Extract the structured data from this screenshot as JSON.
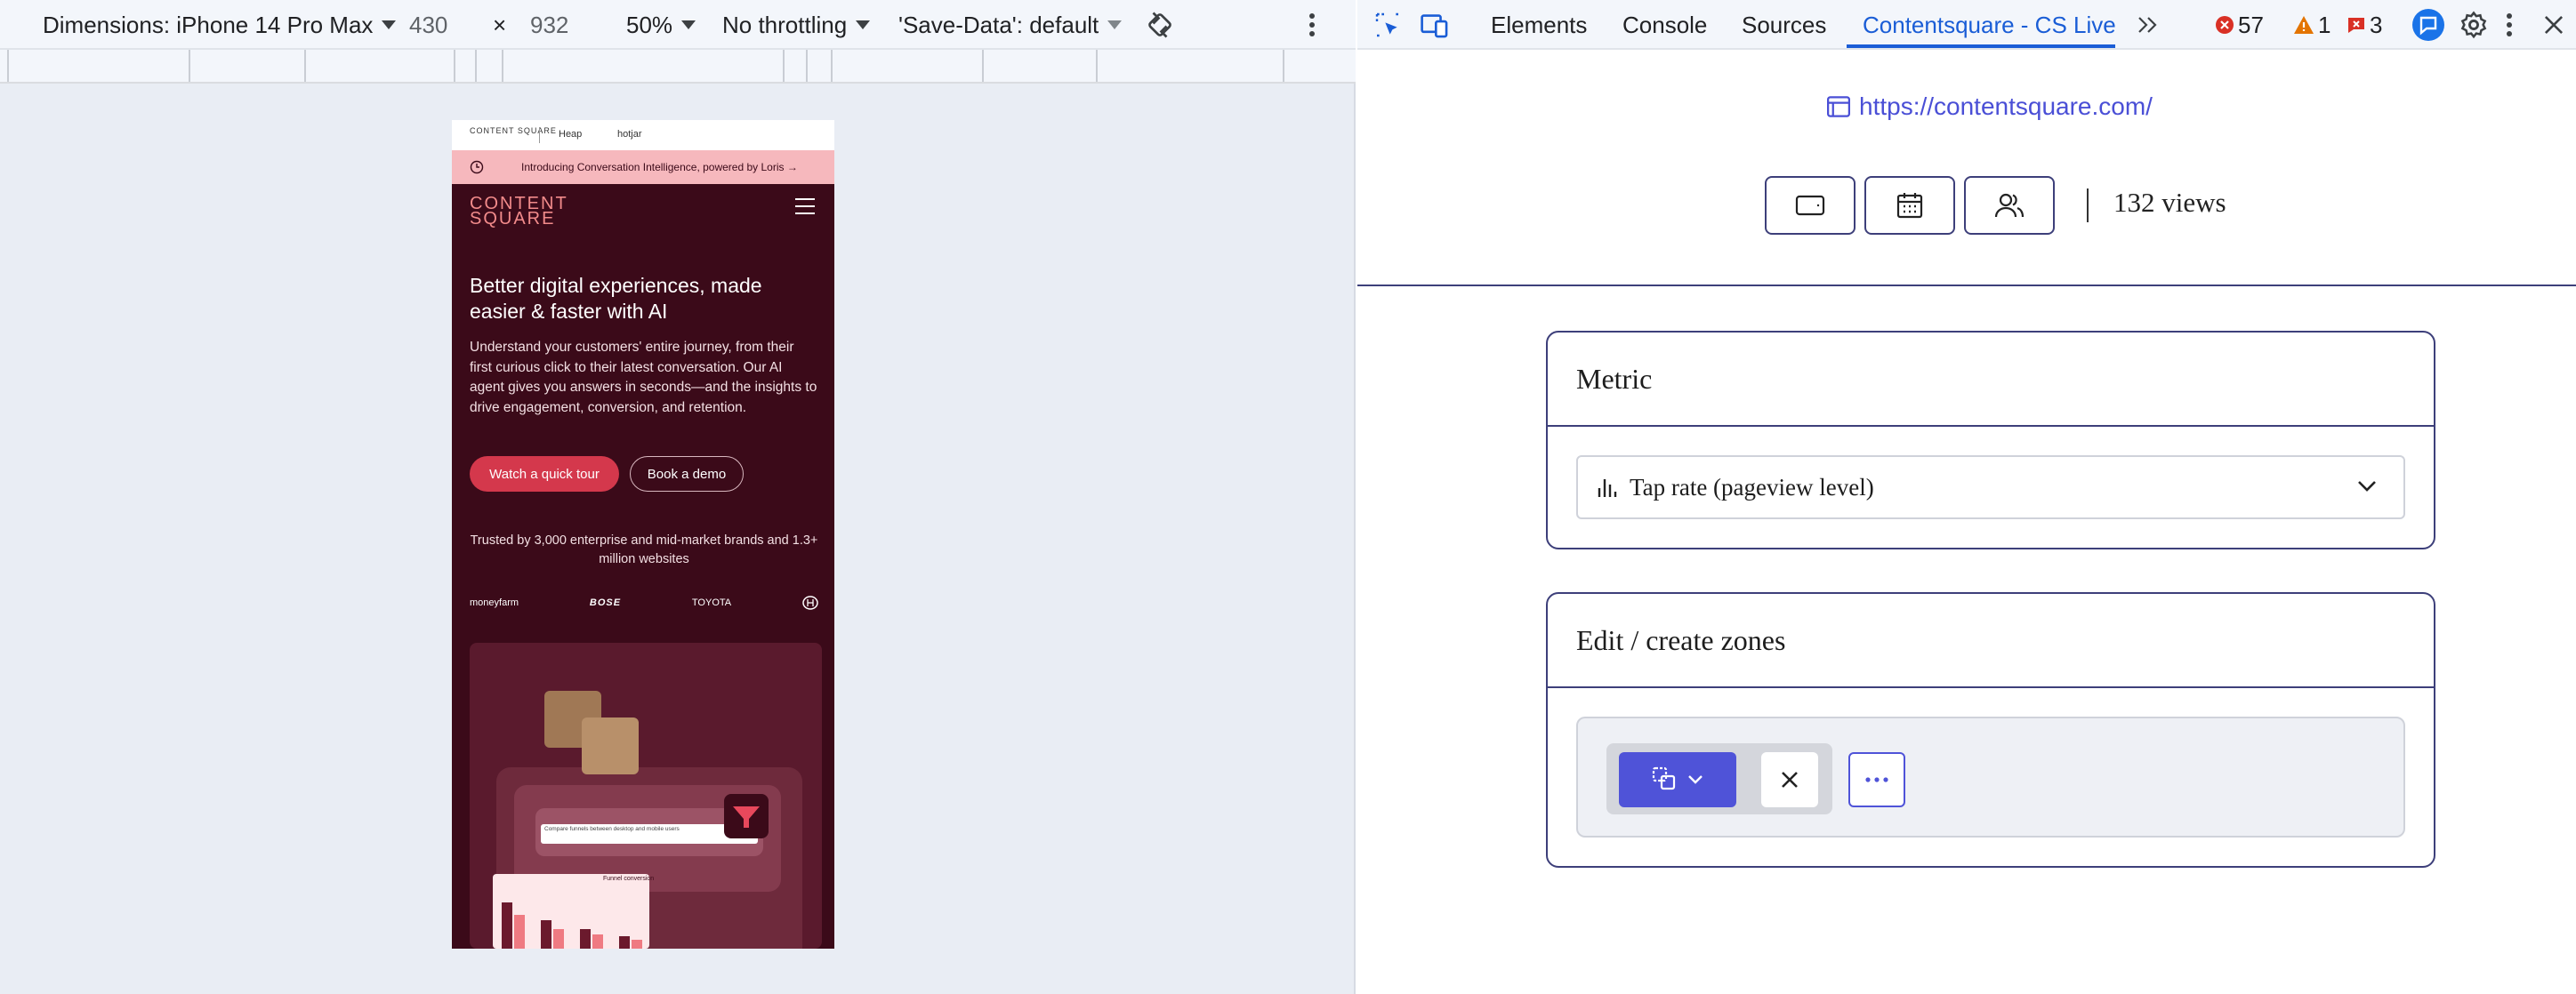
{
  "emulation_toolbar": {
    "device_label": "Dimensions: iPhone 14 Pro Max",
    "width": "430",
    "times": "×",
    "height": "932",
    "zoom": "50%",
    "throttling": "No throttling",
    "save_data": "'Save-Data': default"
  },
  "phone": {
    "brands": [
      "CONTENT SQUARE",
      "Heap",
      "hotjar"
    ],
    "banner": "Introducing Conversation Intelligence, powered by Loris →",
    "logo_line1": "CONTENT",
    "logo_line2": "SQUARE",
    "headline": "Better digital experiences, made easier & faster with AI",
    "paragraph": "Understand your customers' entire journey, from their first curious click to their latest conversation. Our AI agent gives you answers in seconds—and the insights to drive engagement, conversion, and retention.",
    "cta_primary": "Watch a quick tour",
    "cta_secondary": "Book a demo",
    "trust": "Trusted by 3,000 enterprise and mid-market brands and 1.3+ million websites",
    "logos": [
      "moneyfarm",
      "BOSE",
      "TOYOTA"
    ],
    "search_text": "Compare funnels between desktop and mobile users",
    "chart_label": "Funnel conversion"
  },
  "devtools": {
    "tabs": [
      "Elements",
      "Console",
      "Sources",
      "Contentsquare - CS Live"
    ],
    "errors": "57",
    "warnings": "1",
    "issues": "3"
  },
  "cs_live": {
    "url": "https://contentsquare.com/",
    "views": "132 views",
    "metric_title": "Metric",
    "metric_value": "Tap rate (pageview level)",
    "zones_title": "Edit / create zones"
  },
  "colors": {
    "accent": "#4f53d8",
    "brand_dark": "#3b0a19",
    "brand_pink": "#f6b8bd"
  }
}
